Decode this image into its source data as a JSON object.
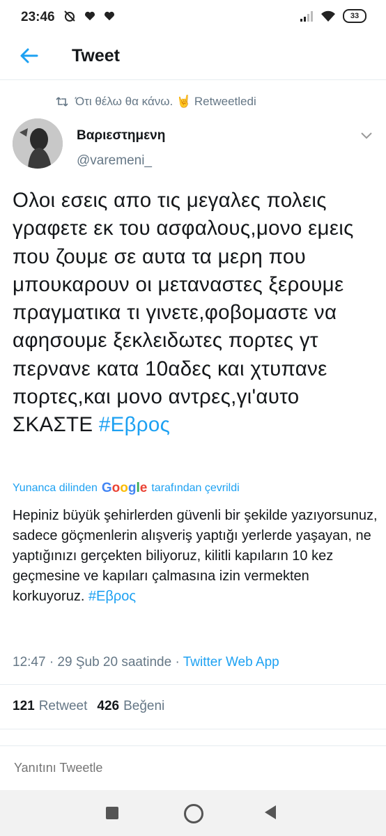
{
  "status_bar": {
    "time": "23:46",
    "battery": "33",
    "left_icons": [
      "no-alarm-icon",
      "heart-icon",
      "heart-icon"
    ],
    "right_icons": [
      "signal-icon",
      "wifi-icon",
      "battery-icon"
    ]
  },
  "header": {
    "title": "Tweet",
    "back_icon": "arrow-left-icon"
  },
  "retweet_context": {
    "text": "Ότι θέλω θα κάνω. 🤘 Retweetledi",
    "icon": "retweet-icon"
  },
  "author": {
    "display_name": "Βαριεστημενη",
    "handle": "@varemeni_"
  },
  "tweet": {
    "text_before": "Ολοι εσεις απο τις μεγαλες πολεις γραφετε εκ του ασφαλους,μονο εμεις που ζουμε σε αυτα τα μερη που μπουκαρουν οι μεταναστες ξερουμε πραγματικα τι γινετε,φοβομαστε να αφησουμε ξεκλειδωτες πορτες γτ περνανε κατα 10αδες και χτυπανε πορτες,και μονο αντρες,γι'αυτο ΣΚΑΣΤΕ ",
    "hashtag": "#Εβρος"
  },
  "translation": {
    "prefix": "Yunanca dilinden",
    "google": "Google",
    "suffix": "tarafından çevrildi",
    "text_before": "Hepiniz büyük şehirlerden güvenli bir şekilde yazıyorsunuz, sadece göçmenlerin alışveriş yaptığı yerlerde yaşayan, ne yaptığınızı gerçekten biliyoruz, kilitli kapıların 10 kez geçmesine ve kapıları çalmasına izin vermekten korkuyoruz. ",
    "hashtag": "#Εβρος"
  },
  "meta": {
    "time_date": "12:47 · 29 Şub 20 saatinde · ",
    "app": "Twitter Web App"
  },
  "stats": {
    "retweets_count": "121",
    "retweets_label": "Retweet",
    "likes_count": "426",
    "likes_label": "Beğeni"
  },
  "reply": {
    "placeholder": "Yanıtını Tweetle"
  },
  "colors": {
    "accent": "#1da1f2",
    "secondary_text": "#657786",
    "primary_text": "#14171a"
  }
}
